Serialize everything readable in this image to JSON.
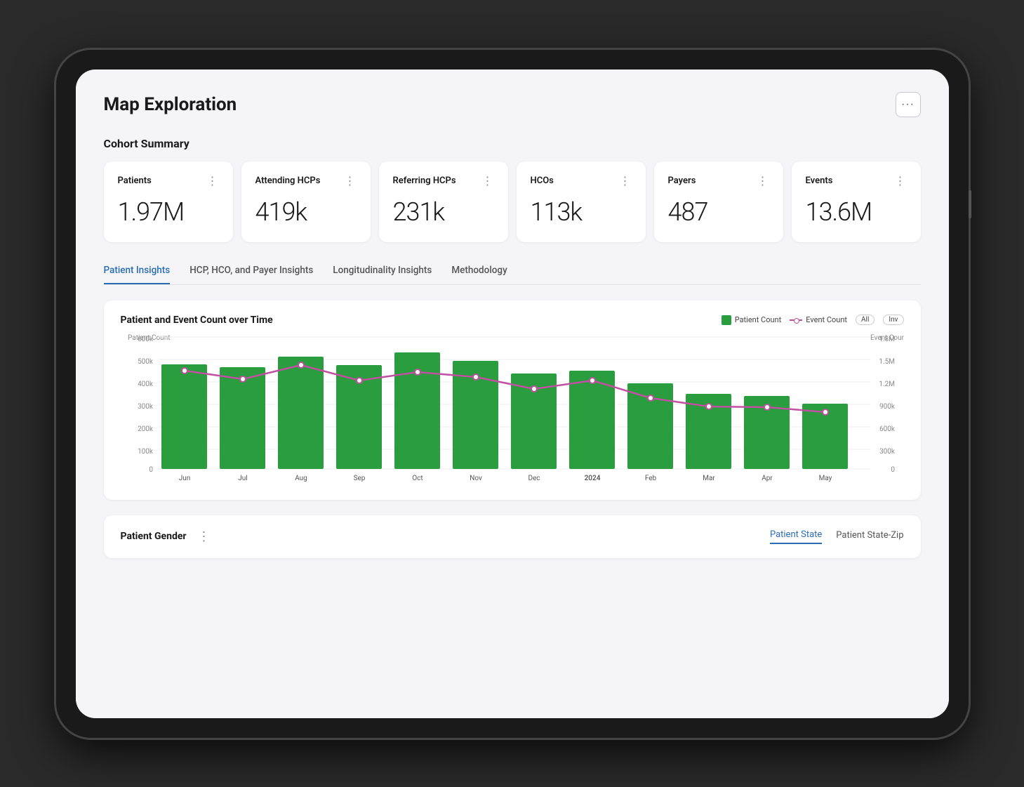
{
  "page": {
    "title": "Map Exploration",
    "menu_icon": "···"
  },
  "cohort_summary": {
    "section_label": "Cohort Summary",
    "cards": [
      {
        "id": "patients",
        "label": "Patients",
        "value": "1.97M"
      },
      {
        "id": "attending-hcps",
        "label": "Attending HCPs",
        "value": "419k"
      },
      {
        "id": "referring-hcps",
        "label": "Referring HCPs",
        "value": "231k"
      },
      {
        "id": "hcos",
        "label": "HCOs",
        "value": "113k"
      },
      {
        "id": "payers",
        "label": "Payers",
        "value": "487"
      },
      {
        "id": "events",
        "label": "Events",
        "value": "13.6M"
      }
    ]
  },
  "tabs": [
    {
      "id": "patient-insights",
      "label": "Patient Insights",
      "active": true
    },
    {
      "id": "hcp-hco-payer",
      "label": "HCP, HCO, and Payer Insights",
      "active": false
    },
    {
      "id": "longitudinality",
      "label": "Longitudinality Insights",
      "active": false
    },
    {
      "id": "methodology",
      "label": "Methodology",
      "active": false
    }
  ],
  "chart": {
    "title": "Patient and Event Count over Time",
    "legend": {
      "patient_count_label": "Patient Count",
      "event_count_label": "Event Count",
      "all_tag": "All",
      "inv_tag": "Inv"
    },
    "y_left_label": "Patient Count",
    "y_right_label": "Event Count",
    "x_labels": [
      "Jun",
      "Jul",
      "Aug",
      "Sep",
      "Oct",
      "Nov",
      "Dec",
      "2024",
      "Feb",
      "Mar",
      "Apr",
      "May"
    ],
    "left_y_labels": [
      "600k",
      "500k",
      "400k",
      "300k",
      "200k",
      "100k",
      "0"
    ],
    "right_y_labels": [
      "1.8M",
      "1.5M",
      "1.2M",
      "900k",
      "600k",
      "300k",
      "0"
    ],
    "bars": [
      480,
      470,
      510,
      478,
      520,
      495,
      445,
      455,
      390,
      340,
      330,
      295
    ],
    "line_points": [
      465,
      420,
      465,
      415,
      455,
      425,
      380,
      420,
      345,
      310,
      305,
      295
    ]
  },
  "bottom": {
    "title": "Patient Gender",
    "menu_icon": "⋮",
    "tabs": [
      {
        "id": "patient-state",
        "label": "Patient State",
        "active": true
      },
      {
        "id": "patient-state-zip",
        "label": "Patient State-Zip",
        "active": false
      }
    ]
  },
  "colors": {
    "accent_blue": "#2a6db5",
    "bar_green": "#2a9d3e",
    "line_pink": "#c050a0",
    "bg_card": "#ffffff",
    "bg_page": "#f5f5f7"
  }
}
